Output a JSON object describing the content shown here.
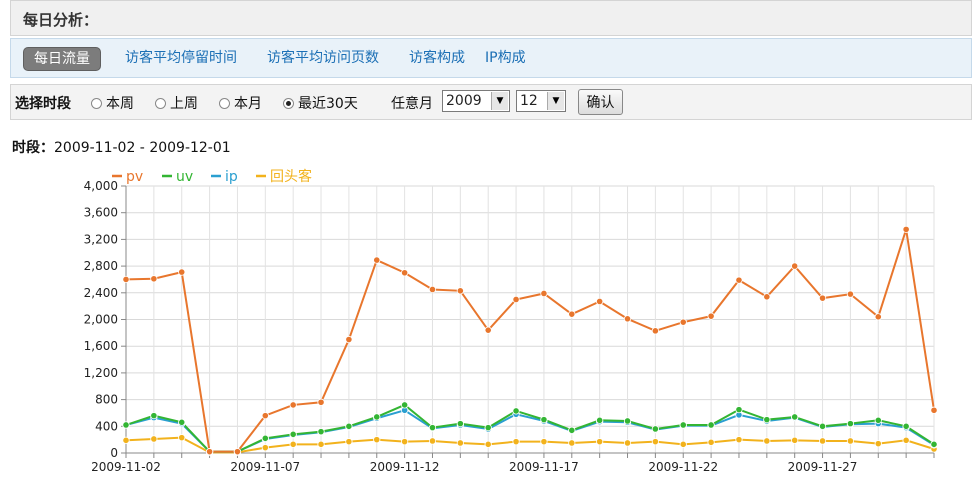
{
  "header": {
    "title": "每日分析："
  },
  "tabs": [
    {
      "label": "每日流量",
      "active": true
    },
    {
      "label": "访客平均停留时间"
    },
    {
      "label": "访客平均访问页数"
    },
    {
      "label": "访客构成"
    },
    {
      "label": "IP构成"
    }
  ],
  "filter": {
    "label": "选择时段",
    "options": [
      {
        "label": "本周",
        "selected": false
      },
      {
        "label": "上周",
        "selected": false
      },
      {
        "label": "本月",
        "selected": false
      },
      {
        "label": "最近30天",
        "selected": true
      }
    ],
    "any_month_label": "任意月",
    "year_value": "2009",
    "month_value": "12",
    "confirm_label": "确认"
  },
  "period": {
    "label": "时段：",
    "value": "2009-11-02 - 2009-12-01"
  },
  "chart_data": {
    "type": "line",
    "x": [
      "2009-11-02",
      "2009-11-03",
      "2009-11-04",
      "2009-11-05",
      "2009-11-06",
      "2009-11-07",
      "2009-11-08",
      "2009-11-09",
      "2009-11-10",
      "2009-11-11",
      "2009-11-12",
      "2009-11-13",
      "2009-11-14",
      "2009-11-15",
      "2009-11-16",
      "2009-11-17",
      "2009-11-18",
      "2009-11-19",
      "2009-11-20",
      "2009-11-21",
      "2009-11-22",
      "2009-11-23",
      "2009-11-24",
      "2009-11-25",
      "2009-11-26",
      "2009-11-27",
      "2009-11-28",
      "2009-11-29",
      "2009-11-30",
      "2009-12-01"
    ],
    "x_tick_labels": [
      "2009-11-02",
      "2009-11-07",
      "2009-11-12",
      "2009-11-17",
      "2009-11-22",
      "2009-11-27"
    ],
    "y_tick_labels": [
      "4,000",
      "3,600",
      "3,200",
      "2,800",
      "2,400",
      "2,000",
      "1,600",
      "1,200",
      "800",
      "400",
      "0"
    ],
    "ylim": [
      0,
      4000
    ],
    "grid": true,
    "legend_position": "top-left",
    "series": [
      {
        "name": "pv",
        "color": "#e8762d",
        "values": [
          2600,
          2610,
          2710,
          20,
          20,
          560,
          720,
          760,
          1700,
          2890,
          2700,
          2450,
          2430,
          1840,
          2300,
          2390,
          2080,
          2270,
          2010,
          1830,
          1960,
          2050,
          2590,
          2340,
          2800,
          2320,
          2380,
          2040,
          3350,
          640
        ]
      },
      {
        "name": "uv",
        "color": "#33b533",
        "values": [
          420,
          560,
          460,
          20,
          20,
          220,
          280,
          320,
          400,
          540,
          720,
          380,
          440,
          380,
          630,
          500,
          340,
          490,
          480,
          360,
          420,
          420,
          650,
          500,
          540,
          400,
          440,
          490,
          400,
          130
        ]
      },
      {
        "name": "ip",
        "color": "#2a9fd0",
        "values": [
          420,
          530,
          440,
          20,
          20,
          210,
          270,
          310,
          390,
          520,
          640,
          370,
          420,
          360,
          580,
          480,
          330,
          470,
          460,
          350,
          410,
          410,
          570,
          480,
          530,
          390,
          430,
          440,
          380,
          120
        ]
      },
      {
        "name": "回头客",
        "color": "#f2b21c",
        "values": [
          190,
          210,
          230,
          10,
          10,
          80,
          130,
          130,
          170,
          200,
          170,
          180,
          150,
          130,
          170,
          170,
          150,
          170,
          150,
          170,
          130,
          160,
          200,
          180,
          190,
          180,
          180,
          140,
          190,
          60
        ]
      }
    ]
  }
}
